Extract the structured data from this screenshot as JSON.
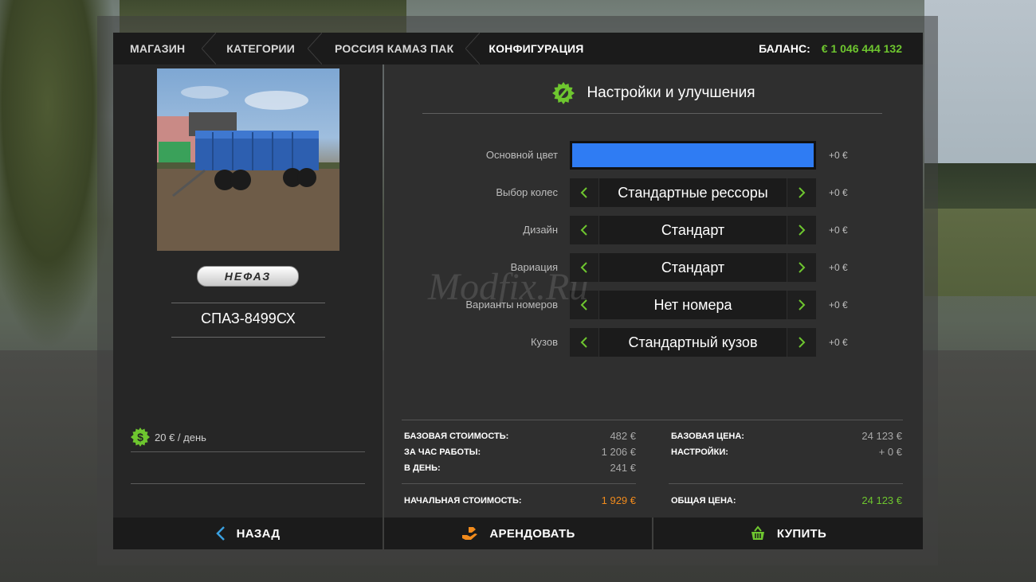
{
  "breadcrumbs": [
    "МАГАЗИН",
    "КАТЕГОРИИ",
    "РОССИЯ КАМАЗ ПАК",
    "КОНФИГУРАЦИЯ"
  ],
  "balance": {
    "label": "БАЛАНС:",
    "value": "€ 1 046 444 132"
  },
  "vehicle": {
    "brand_logo_text": "НЕФАЗ",
    "name": "СПАЗ-8499СХ",
    "upkeep": "20 € / день"
  },
  "config": {
    "title": "Настройки и улучшения",
    "watermark": "Modfix.Ru",
    "options": [
      {
        "label": "Основной цвет",
        "type": "color",
        "color": "#2f7cf3",
        "price": "+0 €"
      },
      {
        "label": "Выбор колес",
        "type": "select",
        "value": "Стандартные рессоры",
        "price": "+0 €"
      },
      {
        "label": "Дизайн",
        "type": "select",
        "value": "Стандарт",
        "price": "+0 €"
      },
      {
        "label": "Вариация",
        "type": "select",
        "value": "Стандарт",
        "price": "+0 €"
      },
      {
        "label": "Варианты номеров",
        "type": "select",
        "value": "Нет номера",
        "price": "+0 €"
      },
      {
        "label": "Кузов",
        "type": "select",
        "value": "Стандартный кузов",
        "price": "+0 €"
      }
    ]
  },
  "summary": {
    "left": [
      {
        "label": "БАЗОВАЯ СТОИМОСТЬ:",
        "value": "482 €"
      },
      {
        "label": "ЗА ЧАС РАБОТЫ:",
        "value": "1 206 €"
      },
      {
        "label": "В ДЕНЬ:",
        "value": "241 €"
      }
    ],
    "left_total": {
      "label": "НАЧАЛЬНАЯ СТОИМОСТЬ:",
      "value": "1 929 €"
    },
    "right": [
      {
        "label": "БАЗОВАЯ ЦЕНА:",
        "value": "24 123 €"
      },
      {
        "label": "НАСТРОЙКИ:",
        "value": "+ 0 €"
      }
    ],
    "right_total": {
      "label": "ОБЩАЯ ЦЕНА:",
      "value": "24 123 €"
    }
  },
  "buttons": {
    "back": "НАЗАД",
    "lease": "АРЕНДОВАТЬ",
    "buy": "КУПИТЬ"
  },
  "colors": {
    "accent_green": "#6ec62f",
    "accent_orange": "#f28b1c",
    "primary_color_swatch": "#2f7cf3"
  }
}
